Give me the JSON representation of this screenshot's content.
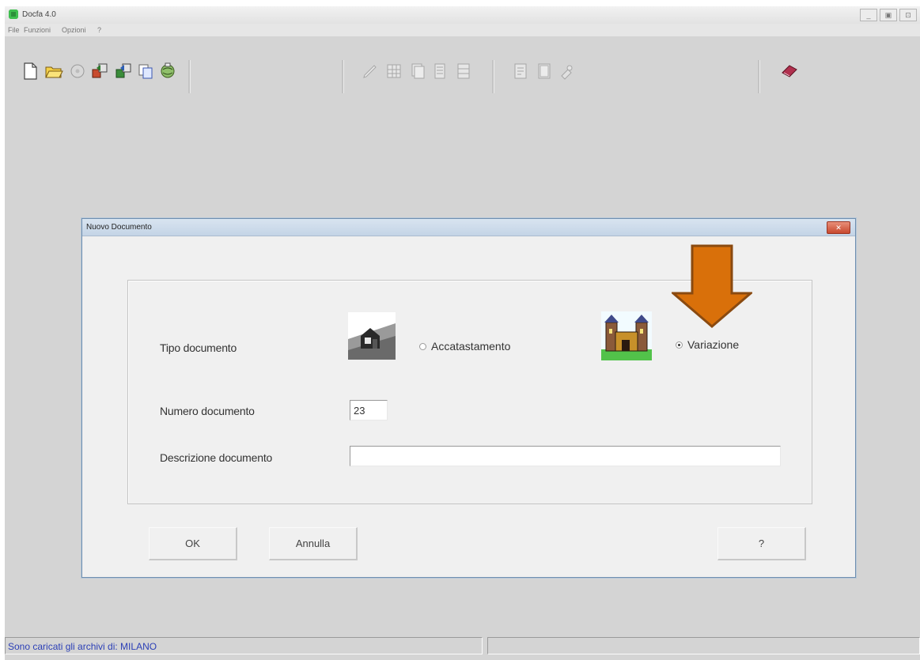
{
  "app": {
    "title": "Docfa 4.0",
    "menu": [
      "File",
      "Funzioni",
      "Opzioni",
      "?"
    ],
    "window_controls": [
      "_",
      "▣",
      "⊡"
    ]
  },
  "toolbar": {
    "icons": [
      "new-document-icon",
      "open-folder-icon",
      "disc-icon",
      "transfer-icon",
      "transfer-alt-icon",
      "copy-icon",
      "globe-icon",
      "pencil-icon",
      "grid-icon",
      "document-pages-icon",
      "list-icon",
      "table-icon",
      "form-icon",
      "book-icon",
      "tools-icon",
      "help-book-icon"
    ]
  },
  "dialog": {
    "title": "Nuovo Documento",
    "close_label": "✕",
    "tipo_label": "Tipo documento",
    "option_accatastamento": "Accatastamento",
    "option_variazione": "Variazione",
    "selected_option": "Variazione",
    "numero_label": "Numero documento",
    "numero_value": "23",
    "descrizione_label": "Descrizione documento",
    "descrizione_value": "",
    "ok_label": "OK",
    "annulla_label": "Annulla",
    "help_label": "?"
  },
  "annotation": {
    "arrow_color": "#d9700a"
  },
  "status": {
    "message": "Sono caricati gli archivi di: MILANO",
    "second_segment": ""
  }
}
